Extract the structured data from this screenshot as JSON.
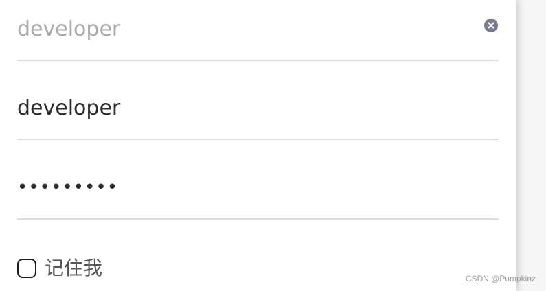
{
  "form": {
    "search": {
      "placeholder": "developer",
      "value": "",
      "clear_icon": "close-circle-icon"
    },
    "username": {
      "value": "developer"
    },
    "password": {
      "masked_value": "•••••••••"
    },
    "remember_me": {
      "label": "记住我",
      "checked": false
    }
  },
  "watermark": "CSDN @Pumpkinz",
  "colors": {
    "divider": "#dcdcdc",
    "clear_icon_bg": "#7a7a8e",
    "placeholder": "#aaaaaa",
    "text": "#2b2b2b"
  }
}
